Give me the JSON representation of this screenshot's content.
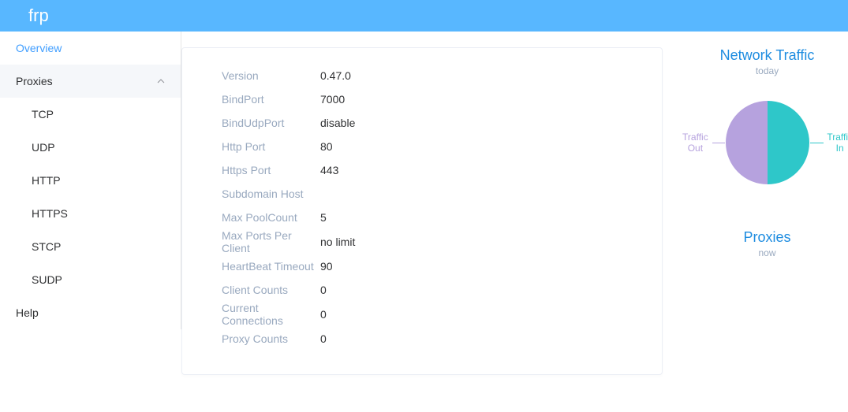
{
  "header": {
    "logo": "frp"
  },
  "sidebar": {
    "overview": "Overview",
    "proxies_label": "Proxies",
    "items": [
      {
        "label": "TCP"
      },
      {
        "label": "UDP"
      },
      {
        "label": "HTTP"
      },
      {
        "label": "HTTPS"
      },
      {
        "label": "STCP"
      },
      {
        "label": "SUDP"
      }
    ],
    "help": "Help"
  },
  "overview": {
    "rows": [
      {
        "label": "Version",
        "value": "0.47.0"
      },
      {
        "label": "BindPort",
        "value": "7000"
      },
      {
        "label": "BindUdpPort",
        "value": "disable"
      },
      {
        "label": "Http Port",
        "value": "80"
      },
      {
        "label": "Https Port",
        "value": "443"
      },
      {
        "label": "Subdomain Host",
        "value": ""
      },
      {
        "label": "Max PoolCount",
        "value": "5"
      },
      {
        "label": "Max Ports Per Client",
        "value": "no limit"
      },
      {
        "label": "HeartBeat Timeout",
        "value": "90"
      },
      {
        "label": "Client Counts",
        "value": "0"
      },
      {
        "label": "Current Connections",
        "value": "0"
      },
      {
        "label": "Proxy Counts",
        "value": "0"
      }
    ]
  },
  "right": {
    "traffic_title": "Network Traffic",
    "traffic_sub": "today",
    "traffic_out_label": "Traffic Out",
    "traffic_in_label": "Traffic In",
    "proxies_title": "Proxies",
    "proxies_sub": "now"
  },
  "chart_data": {
    "type": "pie",
    "title": "Network Traffic",
    "subtitle": "today",
    "series": [
      {
        "name": "Traffic Out",
        "value": 0,
        "color": "#b6a2de"
      },
      {
        "name": "Traffic In",
        "value": 0,
        "color": "#2ec7c9"
      }
    ]
  }
}
